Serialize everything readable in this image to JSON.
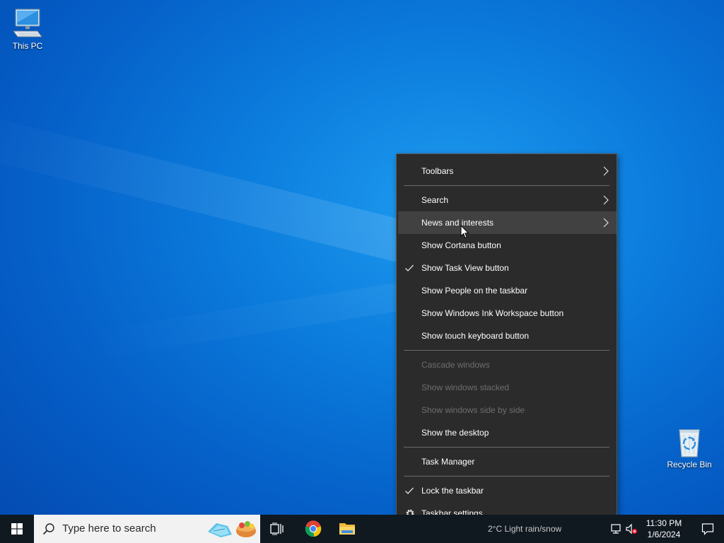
{
  "desktop": {
    "icons": [
      {
        "label": "This PC"
      },
      {
        "label": "Recycle Bin"
      }
    ]
  },
  "context_menu": {
    "items": [
      {
        "label": "Toolbars",
        "submenu": true
      },
      {
        "label": "Search",
        "submenu": true
      },
      {
        "label": "News and interests",
        "submenu": true,
        "hover": true
      },
      {
        "label": "Show Cortana button"
      },
      {
        "label": "Show Task View button",
        "checked": true
      },
      {
        "label": "Show People on the taskbar"
      },
      {
        "label": "Show Windows Ink Workspace button"
      },
      {
        "label": "Show touch keyboard button"
      },
      {
        "label": "Cascade windows",
        "disabled": true
      },
      {
        "label": "Show windows stacked",
        "disabled": true
      },
      {
        "label": "Show windows side by side",
        "disabled": true
      },
      {
        "label": "Show the desktop"
      },
      {
        "label": "Task Manager"
      },
      {
        "label": "Lock the taskbar",
        "checked": true
      },
      {
        "label": "Taskbar settings",
        "icon": "gear-icon"
      }
    ]
  },
  "taskbar": {
    "search_placeholder": "Type here to search",
    "weather_text": "2°C  Light rain/snow",
    "clock": {
      "time": "11:30 PM",
      "date": "1/6/2024"
    }
  },
  "colors": {
    "menu_bg": "#2b2b2b",
    "menu_hover": "#414141",
    "menu_disabled_text": "#6e6e6e",
    "taskbar_bg": "#101820",
    "desktop_blue": "#0b7bdc"
  }
}
